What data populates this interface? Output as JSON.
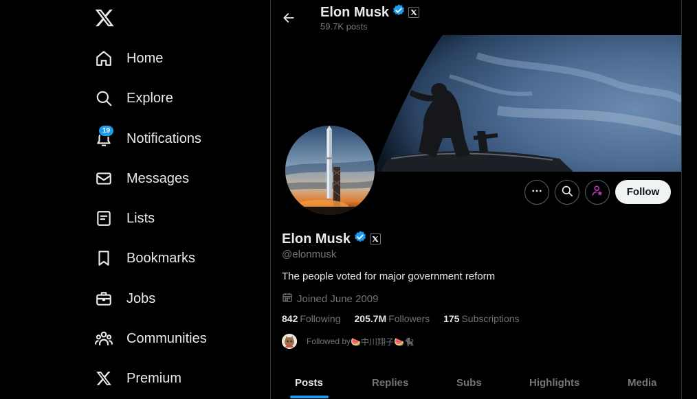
{
  "nav": {
    "items": [
      {
        "label": "Home",
        "icon": "home-icon"
      },
      {
        "label": "Explore",
        "icon": "search-icon"
      },
      {
        "label": "Notifications",
        "icon": "bell-icon",
        "badge": "19"
      },
      {
        "label": "Messages",
        "icon": "envelope-icon"
      },
      {
        "label": "Lists",
        "icon": "list-icon"
      },
      {
        "label": "Bookmarks",
        "icon": "bookmark-icon"
      },
      {
        "label": "Jobs",
        "icon": "briefcase-icon"
      },
      {
        "label": "Communities",
        "icon": "people-icon"
      },
      {
        "label": "Premium",
        "icon": "x-logo-icon"
      }
    ]
  },
  "header": {
    "name": "Elon Musk",
    "posts": "59.7K posts"
  },
  "profile": {
    "name": "Elon Musk",
    "handle": "@elonmusk",
    "bio": "The people voted for major government reform",
    "joined": "Joined June 2009",
    "following_count": "842",
    "following_label": "Following",
    "followers_count": "205.7M",
    "followers_label": "Followers",
    "subscriptions_count": "175",
    "subscriptions_label": "Subscriptions",
    "followed_by_prefix": "Followed by ",
    "followed_by_name": "🍉中川翔子🍉🐈‍⬛",
    "follow_label": "Follow"
  },
  "tabs": [
    "Posts",
    "Replies",
    "Subs",
    "Highlights",
    "Media"
  ],
  "colors": {
    "accent": "#1d9bf0",
    "verified": "#1d9bf0",
    "subscribe": "#c936cc",
    "text": "#e7e9ea",
    "muted": "#71767b"
  }
}
